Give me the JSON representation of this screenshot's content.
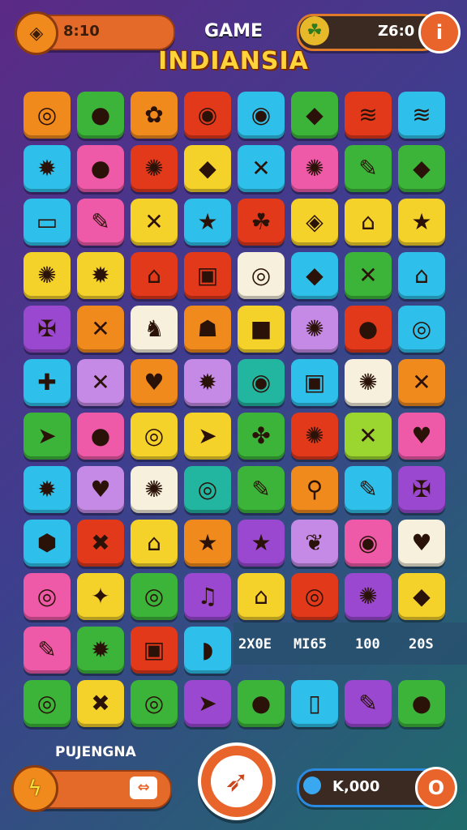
{
  "hud": {
    "timer_value": "8:10",
    "timer_icon": "diamond-icon",
    "score_value": "Z6:0",
    "score_icon": "frog-icon",
    "info_icon": "info-icon"
  },
  "title": {
    "line1": "GAME",
    "line2": "INDIANSIA"
  },
  "colors": {
    "orange": "#f08a1c",
    "red": "#e2391b",
    "green": "#3cb43a",
    "lime": "#9bd630",
    "cyan": "#2ec0ea",
    "yellow": "#f5d22a",
    "purple": "#9a48d0",
    "pink": "#ef5aa8",
    "lavender": "#c48ae6",
    "cream": "#f6f0dc",
    "teal": "#22b5a0"
  },
  "board": {
    "rows": [
      [
        {
          "c": "orange",
          "i": "◎",
          "n": "ring-icon"
        },
        {
          "c": "green",
          "i": "●",
          "n": "strawberry-icon"
        },
        {
          "c": "orange",
          "i": "✿",
          "n": "leaf-icon"
        },
        {
          "c": "red",
          "i": "◉",
          "n": "swirl-icon"
        },
        {
          "c": "cyan",
          "i": "◉",
          "n": "eye-icon"
        },
        {
          "c": "green",
          "i": "◆",
          "n": "leaf-dark-icon"
        },
        {
          "c": "red",
          "i": "≋",
          "n": "layers-icon"
        },
        {
          "c": "cyan",
          "i": "≋",
          "n": "stack-icon"
        }
      ],
      [
        {
          "c": "cyan",
          "i": "✹",
          "n": "gear-icon"
        },
        {
          "c": "pink",
          "i": "●",
          "n": "seed-icon"
        },
        {
          "c": "red",
          "i": "✺",
          "n": "sun-icon"
        },
        {
          "c": "yellow",
          "i": "◆",
          "n": "feather-icon"
        },
        {
          "c": "cyan",
          "i": "✕",
          "n": "cross-icon"
        },
        {
          "c": "pink",
          "i": "✺",
          "n": "flower-icon"
        },
        {
          "c": "green",
          "i": "✎",
          "n": "pin-icon"
        },
        {
          "c": "green",
          "i": "◆",
          "n": "gem-icon"
        }
      ],
      [
        {
          "c": "cyan",
          "i": "▭",
          "n": "flag-icon"
        },
        {
          "c": "pink",
          "i": "✎",
          "n": "carrot-icon"
        },
        {
          "c": "yellow",
          "i": "✕",
          "n": "stripes-icon"
        },
        {
          "c": "cyan",
          "i": "★",
          "n": "star-red-icon"
        },
        {
          "c": "red",
          "i": "☘",
          "n": "monster-icon"
        },
        {
          "c": "yellow",
          "i": "◈",
          "n": "tag-icon"
        },
        {
          "c": "yellow",
          "i": "⌂",
          "n": "hut-icon"
        },
        {
          "c": "yellow",
          "i": "★",
          "n": "star-orange-icon"
        }
      ],
      [
        {
          "c": "yellow",
          "i": "✺",
          "n": "red-flower-icon"
        },
        {
          "c": "yellow",
          "i": "✹",
          "n": "spark-icon"
        },
        {
          "c": "red",
          "i": "⌂",
          "n": "lock-icon"
        },
        {
          "c": "red",
          "i": "▣",
          "n": "box-icon"
        },
        {
          "c": "cream",
          "i": "◎",
          "n": "spiral-icon"
        },
        {
          "c": "cyan",
          "i": "◆",
          "n": "rose-icon"
        },
        {
          "c": "green",
          "i": "✕",
          "n": "tools-icon"
        },
        {
          "c": "cyan",
          "i": "⌂",
          "n": "arch-icon"
        }
      ],
      [
        {
          "c": "purple",
          "i": "✠",
          "n": "tribal-icon"
        },
        {
          "c": "orange",
          "i": "✕",
          "n": "scissors-icon"
        },
        {
          "c": "cream",
          "i": "♞",
          "n": "cat-mask-icon"
        },
        {
          "c": "orange",
          "i": "☗",
          "n": "pot-icon"
        },
        {
          "c": "yellow",
          "i": "■",
          "n": "green-box-icon"
        },
        {
          "c": "lavender",
          "i": "✺",
          "n": "orange-gear-icon"
        },
        {
          "c": "red",
          "i": "●",
          "n": "green-leaf-icon"
        },
        {
          "c": "cyan",
          "i": "◎",
          "n": "bottle-icon"
        }
      ],
      [
        {
          "c": "cyan",
          "i": "✚",
          "n": "purple-flower-icon"
        },
        {
          "c": "lavender",
          "i": "✕",
          "n": "crossed-sticks-icon"
        },
        {
          "c": "orange",
          "i": "♥",
          "n": "fox-icon"
        },
        {
          "c": "lavender",
          "i": "✹",
          "n": "blob-icon"
        },
        {
          "c": "teal",
          "i": "◉",
          "n": "rose-swirl-icon"
        },
        {
          "c": "cyan",
          "i": "▣",
          "n": "cube-icon"
        },
        {
          "c": "cream",
          "i": "✺",
          "n": "fire-icon"
        },
        {
          "c": "orange",
          "i": "✕",
          "n": "spear-icon"
        }
      ],
      [
        {
          "c": "green",
          "i": "➤",
          "n": "rocket-icon"
        },
        {
          "c": "pink",
          "i": "●",
          "n": "green-seed-icon"
        },
        {
          "c": "yellow",
          "i": "◎",
          "n": "target-icon"
        },
        {
          "c": "yellow",
          "i": "➤",
          "n": "dart-icon"
        },
        {
          "c": "green",
          "i": "✤",
          "n": "splash-icon"
        },
        {
          "c": "red",
          "i": "✺",
          "n": "red-gear-icon"
        },
        {
          "c": "lime",
          "i": "✕",
          "n": "wand-icon"
        },
        {
          "c": "pink",
          "i": "♥",
          "n": "pink-heart-icon"
        }
      ],
      [
        {
          "c": "cyan",
          "i": "✹",
          "n": "yellow-sun-icon"
        },
        {
          "c": "lavender",
          "i": "♥",
          "n": "red-heart-icon"
        },
        {
          "c": "cream",
          "i": "✺",
          "n": "blue-burst-icon"
        },
        {
          "c": "teal",
          "i": "◎",
          "n": "blue-spiral-icon"
        },
        {
          "c": "green",
          "i": "✎",
          "n": "pencil-icon"
        },
        {
          "c": "orange",
          "i": "⚲",
          "n": "magnifier-icon"
        },
        {
          "c": "cyan",
          "i": "✎",
          "n": "brush-icon"
        },
        {
          "c": "purple",
          "i": "✠",
          "n": "knot-icon"
        }
      ],
      [
        {
          "c": "cyan",
          "i": "⬢",
          "n": "prism-icon"
        },
        {
          "c": "red",
          "i": "✖",
          "n": "bone-icon"
        },
        {
          "c": "yellow",
          "i": "⌂",
          "n": "temple-icon"
        },
        {
          "c": "orange",
          "i": "★",
          "n": "gold-star-icon"
        },
        {
          "c": "purple",
          "i": "★",
          "n": "orange-star-icon"
        },
        {
          "c": "lavender",
          "i": "❦",
          "n": "shell-icon"
        },
        {
          "c": "pink",
          "i": "◉",
          "n": "power-icon"
        },
        {
          "c": "cream",
          "i": "♥",
          "n": "shield-icon"
        }
      ],
      [
        {
          "c": "pink",
          "i": "◎",
          "n": "yellow-swirl-icon"
        },
        {
          "c": "yellow",
          "i": "✦",
          "n": "bird-icon"
        },
        {
          "c": "green",
          "i": "◎",
          "n": "vine-icon"
        },
        {
          "c": "purple",
          "i": "♫",
          "n": "boot-icon"
        },
        {
          "c": "yellow",
          "i": "⌂",
          "n": "gate-icon"
        },
        {
          "c": "red",
          "i": "◎",
          "n": "green-vine-icon"
        },
        {
          "c": "purple",
          "i": "✺",
          "n": "white-flower-icon"
        },
        {
          "c": "yellow",
          "i": "◆",
          "n": "purple-tile-icon"
        }
      ],
      [
        {
          "c": "pink",
          "i": "✎",
          "n": "crayon-icon"
        },
        {
          "c": "green",
          "i": "✹",
          "n": "red-cog-icon"
        },
        {
          "c": "red",
          "i": "▣",
          "n": "frame-icon"
        },
        {
          "c": "cyan",
          "i": "◗",
          "n": "helmet-icon"
        }
      ],
      [
        {
          "c": "green",
          "i": "◎",
          "n": "disc-icon"
        },
        {
          "c": "yellow",
          "i": "✖",
          "n": "red-x-icon"
        },
        {
          "c": "green",
          "i": "◎",
          "n": "spiral-leaf-icon"
        },
        {
          "c": "purple",
          "i": "➤",
          "n": "yellow-dart-icon"
        },
        {
          "c": "green",
          "i": "●",
          "n": "red-orb-icon"
        },
        {
          "c": "cyan",
          "i": "▯",
          "n": "jar-icon"
        },
        {
          "c": "purple",
          "i": "✎",
          "n": "pen-icon"
        },
        {
          "c": "green",
          "i": "●",
          "n": "face-icon"
        }
      ]
    ]
  },
  "stats": {
    "s1": "2X0E",
    "s2": "MI65",
    "s3": "100",
    "s4": "20S"
  },
  "bottom": {
    "label": "PUJENGNA",
    "power_icon": "lightning-icon",
    "arrow_icon": "double-arrow-icon",
    "center_icon": "feather-button-icon",
    "coins_value": "K,000",
    "coin_icon": "coin-icon"
  }
}
